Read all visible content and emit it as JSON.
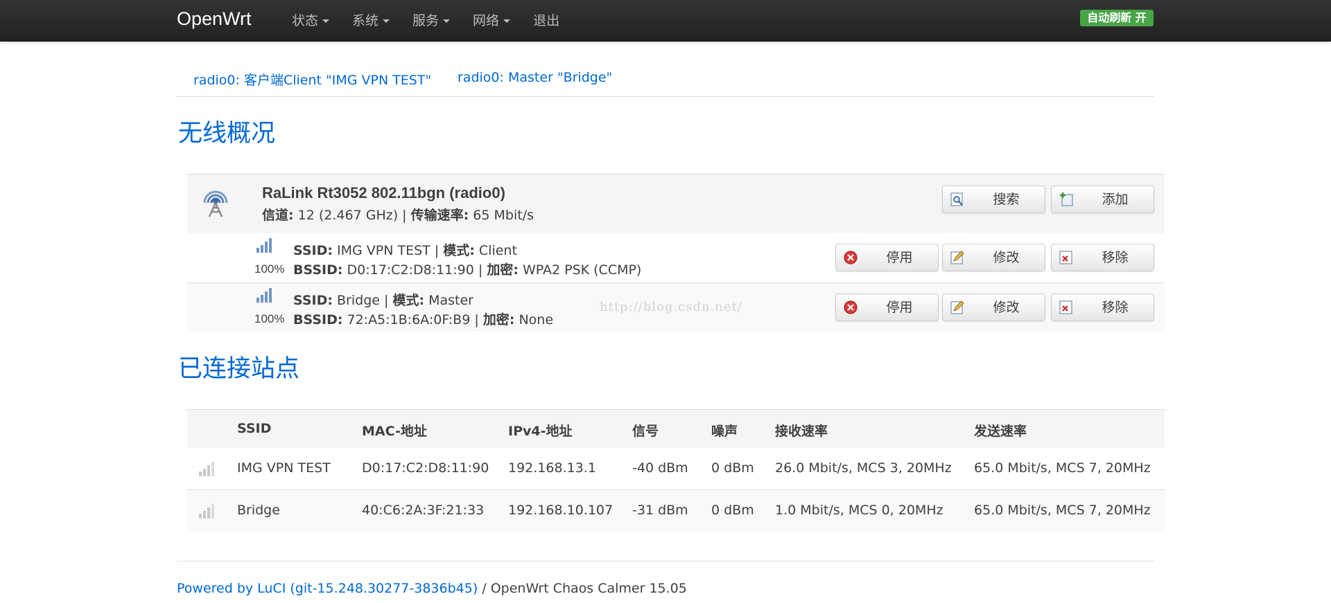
{
  "navbar": {
    "brand": "OpenWrt",
    "menu": [
      {
        "label": "状态"
      },
      {
        "label": "系统"
      },
      {
        "label": "服务"
      },
      {
        "label": "网络"
      },
      {
        "label": "退出"
      }
    ],
    "autorefresh": "自动刷新 开",
    "autorefresh_color": "#46a546"
  },
  "tabs": [
    {
      "label": "radio0: 客户端Client \"IMG VPN TEST\""
    },
    {
      "label": "radio0: Master \"Bridge\""
    }
  ],
  "wireless_overview": {
    "heading": "无线概况",
    "radio": {
      "icon": "wifi-radio-icon",
      "title": "RaLink Rt3052 802.11bgn (radio0)",
      "channel_label": "信道:",
      "channel_value": "12 (2.467 GHz)",
      "sep": "|",
      "rate_label": "传输速率:",
      "rate_value": "65 Mbit/s",
      "buttons": {
        "scan": "搜索",
        "add": "添加"
      }
    },
    "networks": [
      {
        "signal_pct": "100%",
        "ssid_label": "SSID:",
        "ssid": "IMG VPN TEST",
        "mode_label": "模式:",
        "mode": "Client",
        "bssid_label": "BSSID:",
        "bssid": "D0:17:C2:D8:11:90",
        "enc_label": "加密:",
        "encryption": "WPA2 PSK (CCMP)",
        "buttons": {
          "disable": "停用",
          "edit": "修改",
          "remove": "移除"
        }
      },
      {
        "signal_pct": "100%",
        "ssid_label": "SSID:",
        "ssid": "Bridge",
        "mode_label": "模式:",
        "mode": "Master",
        "bssid_label": "BSSID:",
        "bssid": "72:A5:1B:6A:0F:B9",
        "enc_label": "加密:",
        "encryption": "None",
        "buttons": {
          "disable": "停用",
          "edit": "修改",
          "remove": "移除"
        }
      }
    ]
  },
  "stations": {
    "heading": "已连接站点",
    "columns": [
      "SSID",
      "MAC-地址",
      "IPv4-地址",
      "信号",
      "噪声",
      "接收速率",
      "发送速率"
    ],
    "rows": [
      {
        "ssid": "IMG VPN TEST",
        "mac": "D0:17:C2:D8:11:90",
        "ipv4": "192.168.13.1",
        "signal": "-40 dBm",
        "noise": "0 dBm",
        "rx": "26.0 Mbit/s, MCS 3, 20MHz",
        "tx": "65.0 Mbit/s, MCS 7, 20MHz"
      },
      {
        "ssid": "Bridge",
        "mac": "40:C6:2A:3F:21:33",
        "ipv4": "192.168.10.107",
        "signal": "-31 dBm",
        "noise": "0 dBm",
        "rx": "1.0 Mbit/s, MCS 0, 20MHz",
        "tx": "65.0 Mbit/s, MCS 7, 20MHz"
      }
    ]
  },
  "watermark": "http://blog.csdn.net/",
  "footer": {
    "link": "Powered by LuCI (git-15.248.30277-3836b45)",
    "text": " / OpenWrt Chaos Calmer 15.05"
  },
  "colors": {
    "link": "#0069d6",
    "navbar": "#222222"
  }
}
